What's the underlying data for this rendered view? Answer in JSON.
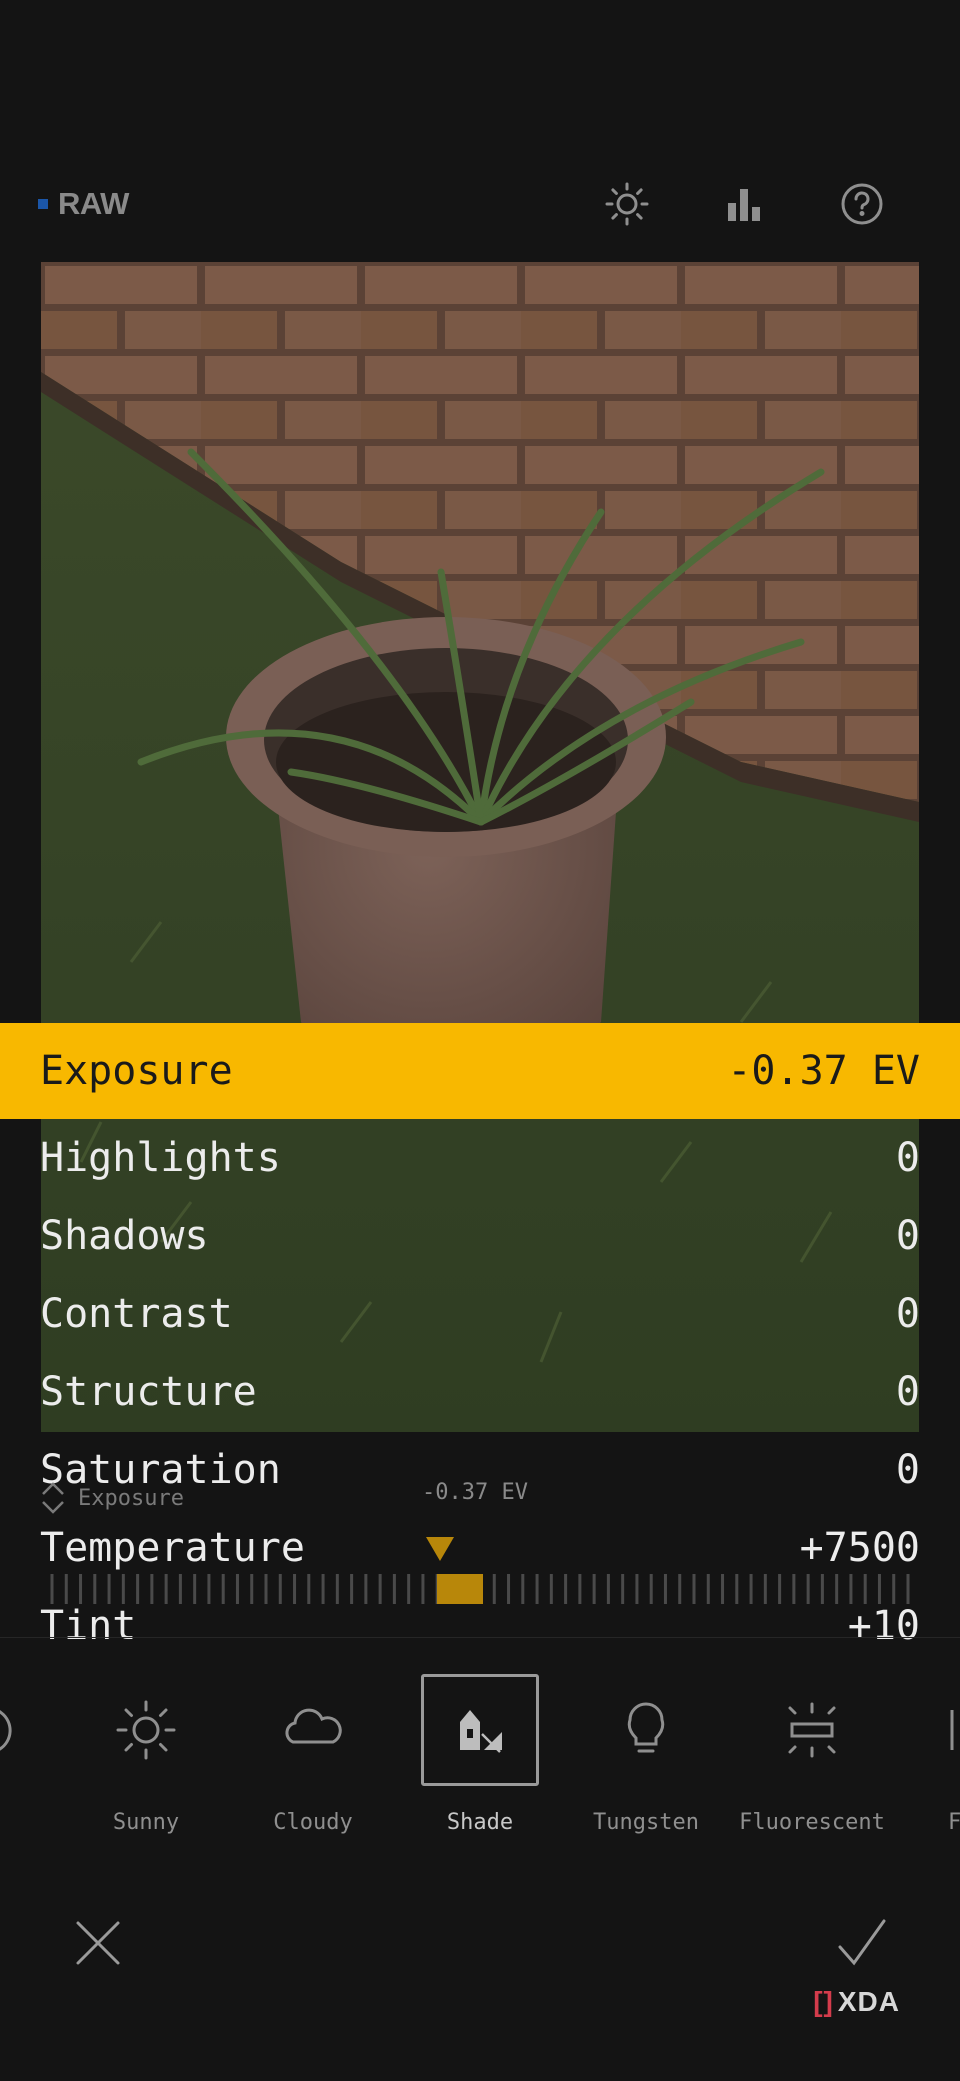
{
  "header": {
    "raw_label": "RAW",
    "icons": [
      "brightness-icon",
      "histogram-icon",
      "help-icon"
    ]
  },
  "adjustments": [
    {
      "label": "Exposure",
      "value": "-0.37 EV",
      "active": true
    },
    {
      "label": "Highlights",
      "value": "0"
    },
    {
      "label": "Shadows",
      "value": "0"
    },
    {
      "label": "Contrast",
      "value": "0"
    },
    {
      "label": "Structure",
      "value": "0"
    },
    {
      "label": "Saturation",
      "value": "0"
    },
    {
      "label": "Temperature",
      "value": "+7500"
    },
    {
      "label": "Tint",
      "value": "+10"
    }
  ],
  "slider": {
    "caption": "Exposure",
    "value": "-0.37 EV",
    "accent": "#b8870a"
  },
  "white_balance_presets": [
    {
      "label": "o",
      "icon": "auto-icon"
    },
    {
      "label": "Sunny",
      "icon": "sun-icon"
    },
    {
      "label": "Cloudy",
      "icon": "cloud-icon"
    },
    {
      "label": "Shade",
      "icon": "shade-icon",
      "selected": true
    },
    {
      "label": "Tungsten",
      "icon": "bulb-icon"
    },
    {
      "label": "Fluorescent",
      "icon": "fluorescent-icon"
    },
    {
      "label": "F",
      "icon": "flash-icon"
    }
  ],
  "actions": {
    "cancel_icon": "close-icon",
    "confirm_icon": "check-icon"
  },
  "watermark": {
    "text": "XDA"
  },
  "colors": {
    "background": "#141414",
    "active_row": "#f8b800",
    "raw_dot": "#1b56a8"
  }
}
